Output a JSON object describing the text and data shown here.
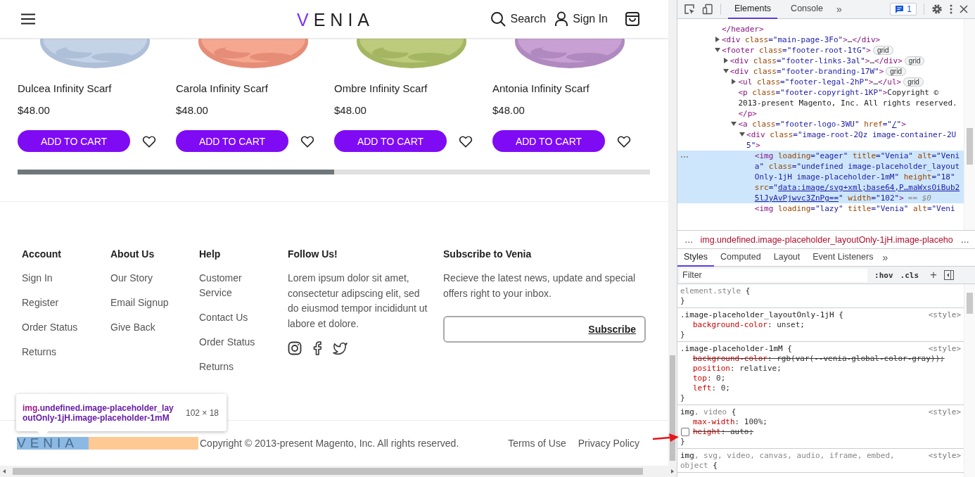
{
  "header": {
    "logo_first": "V",
    "logo_rest": "ENIA",
    "search": "Search",
    "sign_in": "Sign In"
  },
  "products": [
    {
      "name": "Dulcea Infinity Scarf",
      "price": "$48.00",
      "button": "ADD TO CART"
    },
    {
      "name": "Carola Infinity Scarf",
      "price": "$48.00",
      "button": "ADD TO CART"
    },
    {
      "name": "Ombre Infinity Scarf",
      "price": "$48.00",
      "button": "ADD TO CART"
    },
    {
      "name": "Antonia Infinity Scarf",
      "price": "$48.00",
      "button": "ADD TO CART"
    }
  ],
  "footer": {
    "columns": [
      {
        "kind": "links",
        "heading": "Account",
        "links": [
          "Sign In",
          "Register",
          "Order Status",
          "Returns"
        ]
      },
      {
        "kind": "links",
        "heading": "About Us",
        "links": [
          "Our Story",
          "Email Signup",
          "Give Back"
        ]
      },
      {
        "kind": "links",
        "heading": "Help",
        "links": [
          "Customer Service",
          "Contact Us",
          "Order Status",
          "Returns"
        ]
      },
      {
        "kind": "social",
        "heading": "Follow Us!",
        "text": "Lorem ipsum dolor sit amet, consectetur adipscing elit, sed do eiusmod tempor incididunt ut labore et dolore."
      },
      {
        "kind": "subscribe",
        "heading": "Subscribe to Venia",
        "text": "Recieve the latest news, update and special offers right to your inbox.",
        "button": "Subscribe"
      }
    ]
  },
  "bottom": {
    "logo": "VENIA",
    "copyright": "Copyright © 2013-present Magento, Inc. All rights reserved.",
    "legal": [
      "Terms of Use",
      "Privacy Policy"
    ]
  },
  "tooltip": {
    "tag": "img",
    "classes": ".undefined.image-placeholder_layoutOnly-1jH.image-placeholder-1mM",
    "size": "102 × 18"
  },
  "devtools": {
    "tabs": [
      {
        "label": "Elements",
        "selected": true
      },
      {
        "label": "Console",
        "selected": false
      }
    ],
    "more": "»",
    "issues": "1",
    "tree": [
      {
        "kind": "leaf",
        "selected": false,
        "tokens": [
          {
            "kind": "tag",
            "text": "</header>"
          }
        ]
      },
      {
        "kind": "parent",
        "expanded": false,
        "selected": false,
        "tokens": [
          {
            "kind": "tag",
            "text": "<div"
          },
          {
            "kind": "attr",
            "text": " class"
          },
          {
            "kind": "val",
            "text": "=\"main-page-3Fo\""
          },
          {
            "kind": "tag",
            "text": ">"
          },
          {
            "kind": "text",
            "text": "…"
          },
          {
            "kind": "tag",
            "text": "</div>"
          }
        ]
      },
      {
        "kind": "parent",
        "expanded": true,
        "selected": false,
        "badge": "grid",
        "tokens": [
          {
            "kind": "tag",
            "text": "<footer"
          },
          {
            "kind": "attr",
            "text": " class"
          },
          {
            "kind": "val",
            "text": "=\"footer-root-1tG\""
          },
          {
            "kind": "tag",
            "text": ">"
          }
        ],
        "children": [
          {
            "kind": "parent",
            "expanded": false,
            "selected": false,
            "badge": "grid",
            "tokens": [
              {
                "kind": "tag",
                "text": "<div"
              },
              {
                "kind": "attr",
                "text": " class"
              },
              {
                "kind": "val",
                "text": "=\"footer-links-3al\""
              },
              {
                "kind": "tag",
                "text": ">"
              },
              {
                "kind": "text",
                "text": "…"
              },
              {
                "kind": "tag",
                "text": "</div>"
              }
            ]
          },
          {
            "kind": "parent",
            "expanded": true,
            "selected": false,
            "badge": "grid",
            "tokens": [
              {
                "kind": "tag",
                "text": "<div"
              },
              {
                "kind": "attr",
                "text": " class"
              },
              {
                "kind": "val",
                "text": "=\"footer-branding-17W\""
              },
              {
                "kind": "tag",
                "text": ">"
              }
            ],
            "children": [
              {
                "kind": "parent",
                "expanded": false,
                "selected": false,
                "badge": "grid",
                "tokens": [
                  {
                    "kind": "tag",
                    "text": "<ul"
                  },
                  {
                    "kind": "attr",
                    "text": " class"
                  },
                  {
                    "kind": "val",
                    "text": "=\"footer-legal-2hP\""
                  },
                  {
                    "kind": "tag",
                    "text": ">"
                  },
                  {
                    "kind": "text",
                    "text": "…"
                  },
                  {
                    "kind": "tag",
                    "text": "</ul>"
                  }
                ]
              },
              {
                "kind": "leaf",
                "selected": false,
                "tokens": [
                  {
                    "kind": "tag",
                    "text": "<p"
                  },
                  {
                    "kind": "attr",
                    "text": " class"
                  },
                  {
                    "kind": "val",
                    "text": "=\"footer-copyright-1KP\""
                  },
                  {
                    "kind": "tag",
                    "text": ">"
                  },
                  {
                    "kind": "text",
                    "text": "Copyright © 2013-present Magento, Inc. All rights reserved."
                  },
                  {
                    "kind": "tag",
                    "text": "</p>"
                  }
                ]
              },
              {
                "kind": "parent",
                "expanded": true,
                "selected": false,
                "tokens": [
                  {
                    "kind": "tag",
                    "text": "<a"
                  },
                  {
                    "kind": "attr",
                    "text": " class"
                  },
                  {
                    "kind": "val",
                    "text": "=\"footer-logo-3WU\""
                  },
                  {
                    "kind": "attr",
                    "text": " href"
                  },
                  {
                    "kind": "val",
                    "text": "=\""
                  },
                  {
                    "kind": "link",
                    "text": "/"
                  },
                  {
                    "kind": "val",
                    "text": "\""
                  },
                  {
                    "kind": "tag",
                    "text": ">"
                  }
                ],
                "children": [
                  {
                    "kind": "parent",
                    "expanded": true,
                    "selected": false,
                    "tokens": [
                      {
                        "kind": "tag",
                        "text": "<div"
                      },
                      {
                        "kind": "attr",
                        "text": " class"
                      },
                      {
                        "kind": "val",
                        "text": "=\"image-root-2Qz image-container-2U5\""
                      },
                      {
                        "kind": "tag",
                        "text": ">"
                      }
                    ],
                    "children": [
                      {
                        "kind": "leaf",
                        "selected": true,
                        "marker": "== $0",
                        "tokens": [
                          {
                            "kind": "tag",
                            "text": "<img"
                          },
                          {
                            "kind": "attr",
                            "text": " loading"
                          },
                          {
                            "kind": "val",
                            "text": "=\"eager\""
                          },
                          {
                            "kind": "attr",
                            "text": " title"
                          },
                          {
                            "kind": "val",
                            "text": "=\"Venia\""
                          },
                          {
                            "kind": "attr",
                            "text": " alt"
                          },
                          {
                            "kind": "val",
                            "text": "=\"Venia\""
                          },
                          {
                            "kind": "attr",
                            "text": " class"
                          },
                          {
                            "kind": "val",
                            "text": "=\"undefined image-placeholder_layoutOnly-1jH image-placeholder-1mM\""
                          },
                          {
                            "kind": "attr",
                            "text": " height"
                          },
                          {
                            "kind": "val",
                            "text": "=\"18\""
                          },
                          {
                            "kind": "attr",
                            "text": " src"
                          },
                          {
                            "kind": "val",
                            "text": "=\""
                          },
                          {
                            "kind": "link",
                            "text": "data:image/svg+xml;base64,P…maWxsOiBub25lJyAvPjwvc3ZnPg=="
                          },
                          {
                            "kind": "val",
                            "text": "\""
                          },
                          {
                            "kind": "attr",
                            "text": " width"
                          },
                          {
                            "kind": "val",
                            "text": "=\"102\""
                          },
                          {
                            "kind": "tag",
                            "text": ">"
                          }
                        ]
                      },
                      {
                        "kind": "leaf",
                        "selected": false,
                        "tokens": [
                          {
                            "kind": "tag",
                            "text": "<img"
                          },
                          {
                            "kind": "attr",
                            "text": " loading"
                          },
                          {
                            "kind": "val",
                            "text": "=\"lazy\""
                          },
                          {
                            "kind": "attr",
                            "text": " title"
                          },
                          {
                            "kind": "val",
                            "text": "=\"Venia\""
                          },
                          {
                            "kind": "attr",
                            "text": " alt"
                          },
                          {
                            "kind": "val",
                            "text": "=\"Veni"
                          }
                        ]
                      }
                    ]
                  }
                ]
              }
            ]
          }
        ]
      }
    ],
    "breadcrumb": {
      "lead": "…",
      "path": "img.undefined.image-placeholder_layoutOnly-1jH.image-placeho",
      "trail": "…"
    },
    "style_tabs": [
      {
        "label": "Styles",
        "selected": true
      },
      {
        "label": "Computed",
        "selected": false
      },
      {
        "label": "Layout",
        "selected": false
      },
      {
        "label": "Event Listeners",
        "selected": false
      }
    ],
    "style_more": "»",
    "filter": {
      "placeholder": "Filter"
    },
    "hov": ":hov",
    "cls": ".cls",
    "add": "+",
    "rules": [
      {
        "selector": [
          {
            "text": "element.style",
            "matched": false
          },
          {
            "text": " {",
            "matched": true
          }
        ],
        "close": "}"
      },
      {
        "selector": [
          {
            "text": ".image-placeholder_layoutOnly-1jH {",
            "matched": true
          }
        ],
        "source": "<style>",
        "close": "}",
        "props": [
          {
            "name": "background-color",
            "value": ": unset;",
            "overridden": false,
            "disabled": false
          }
        ]
      },
      {
        "selector": [
          {
            "text": ".image-placeholder-1mM {",
            "matched": true
          }
        ],
        "source": "<style>",
        "close": "}",
        "props": [
          {
            "name": "background-color",
            "value": ": rgb(var(--venia-global-color-gray));",
            "overridden": true,
            "disabled": false
          },
          {
            "name": "position",
            "value": ": relative;",
            "overridden": false,
            "disabled": false
          },
          {
            "name": "top",
            "value": ": 0;",
            "overridden": false,
            "disabled": false
          },
          {
            "name": "left",
            "value": ": 0;",
            "overridden": false,
            "disabled": false
          }
        ]
      },
      {
        "selector": [
          {
            "text": "img",
            "matched": true
          },
          {
            "text": ", video",
            "matched": false
          },
          {
            "text": " {",
            "matched": true
          }
        ],
        "source": "<style>",
        "close": "}",
        "props": [
          {
            "name": "max-width",
            "value": ": 100%;",
            "overridden": false,
            "disabled": false
          },
          {
            "name": "height",
            "value": ": auto;",
            "overridden": false,
            "disabled": true
          }
        ]
      },
      {
        "selector": [
          {
            "text": "img",
            "matched": true
          },
          {
            "text": ", svg, video, canvas, audio, iframe, embed, object",
            "matched": false
          },
          {
            "text": " {",
            "matched": true
          }
        ],
        "source": "<style>"
      }
    ]
  }
}
